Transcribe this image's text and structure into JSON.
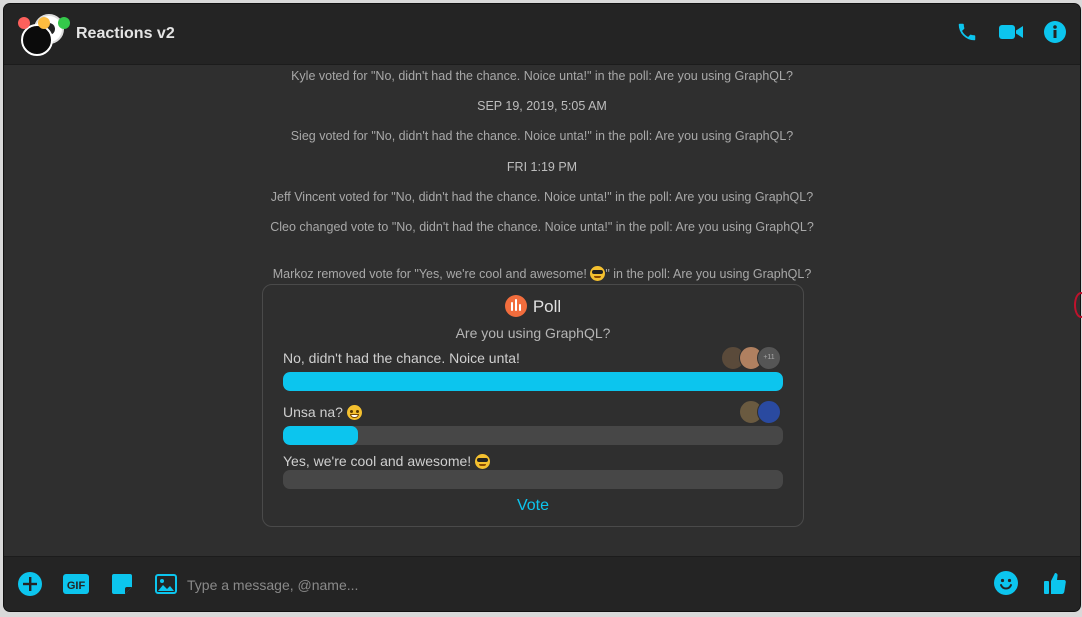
{
  "window": {
    "title": "Reactions v2"
  },
  "header_icons": [
    "phone-icon",
    "video-camera-icon",
    "info-icon"
  ],
  "messages": [
    {
      "type": "system",
      "text": "Kyle voted for \"No, didn't had the chance. Noice unta!\" in the poll: Are you using GraphQL?"
    },
    {
      "type": "timestamp",
      "text": "SEP 19, 2019, 5:05 AM"
    },
    {
      "type": "system",
      "text": "Sieg voted for \"No, didn't had the chance. Noice unta!\" in the poll: Are you using GraphQL?"
    },
    {
      "type": "timestamp",
      "text": "FRI 1:19 PM"
    },
    {
      "type": "system",
      "text": "Jeff Vincent voted for \"No, didn't had the chance. Noice unta!\" in the poll: Are you using GraphQL?"
    },
    {
      "type": "system",
      "text": "Cleo changed vote to \"No, didn't had the chance. Noice unta!\" in the poll: Are you using GraphQL?"
    },
    {
      "type": "system",
      "text_before": "Markoz removed vote for \"Yes, we're cool and awesome! ",
      "text_after": "\" in the poll: Are you using GraphQL?"
    }
  ],
  "poll": {
    "heading": "Poll",
    "question": "Are you using GraphQL?",
    "options": [
      {
        "label": "No, didn't had the chance. Noice unta!",
        "fraction": 1.0,
        "more_voters": "+11"
      },
      {
        "label": "Unsa na? ",
        "fraction": 0.15
      },
      {
        "label": "Yes, we're cool and awesome! ",
        "fraction": 0.0
      }
    ],
    "vote_label": "Vote"
  },
  "composer": {
    "placeholder": "Type a message, @name...",
    "gif_label": "GIF"
  },
  "colors": {
    "accent": "#0cc5ee",
    "poll_icon": "#f26d3d",
    "background": "#2f2f2f",
    "header": "#242424"
  }
}
